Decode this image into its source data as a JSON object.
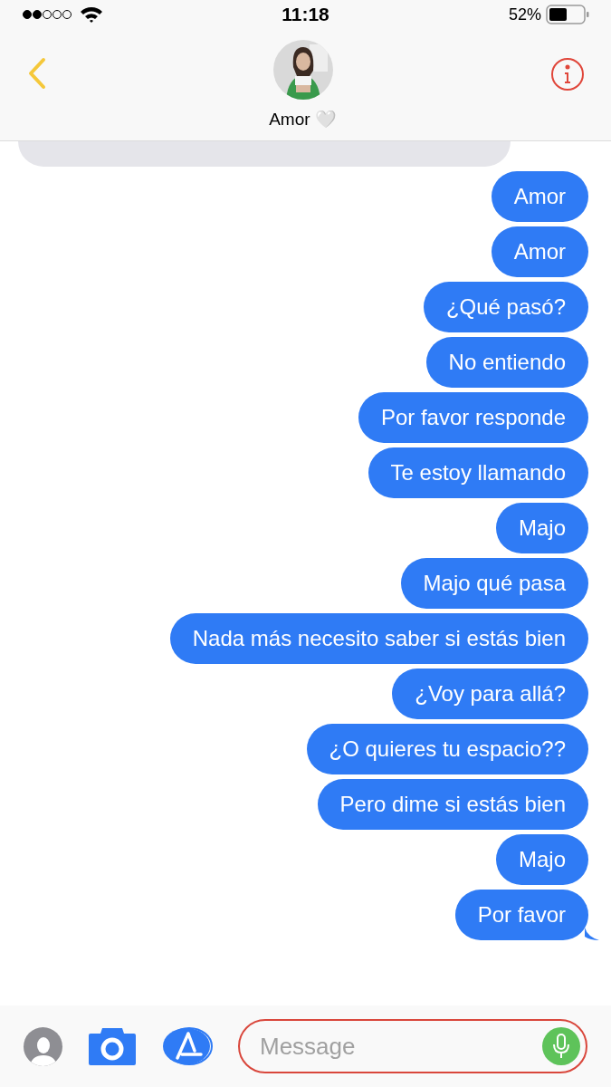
{
  "status_bar": {
    "time": "11:18",
    "battery": "52%"
  },
  "contact": {
    "name": "Amor 🤍"
  },
  "messages": [
    {
      "kind": "incoming"
    },
    {
      "kind": "outgoing",
      "text": "Amor"
    },
    {
      "kind": "outgoing",
      "text": "Amor"
    },
    {
      "kind": "outgoing",
      "text": "¿Qué pasó?"
    },
    {
      "kind": "outgoing",
      "text": "No entiendo"
    },
    {
      "kind": "outgoing",
      "text": "Por favor responde"
    },
    {
      "kind": "outgoing",
      "text": "Te estoy llamando"
    },
    {
      "kind": "outgoing",
      "text": "Majo"
    },
    {
      "kind": "outgoing",
      "text": "Majo qué pasa"
    },
    {
      "kind": "outgoing",
      "text": "Nada más necesito saber si estás bien"
    },
    {
      "kind": "outgoing",
      "text": "¿Voy para allá?"
    },
    {
      "kind": "outgoing",
      "text": "¿O quieres tu espacio??"
    },
    {
      "kind": "outgoing",
      "text": "Pero dime si estás bien"
    },
    {
      "kind": "outgoing",
      "text": "Majo"
    },
    {
      "kind": "outgoing",
      "text": "Por favor"
    }
  ],
  "composer": {
    "placeholder": "Message"
  }
}
